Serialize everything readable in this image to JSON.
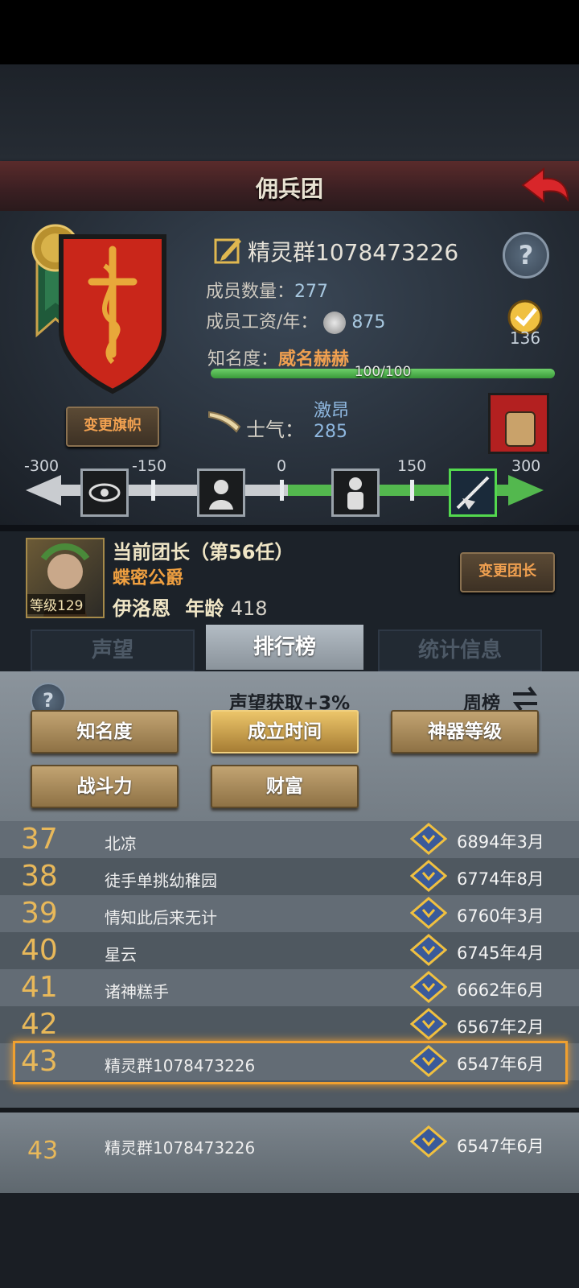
{
  "header": {
    "title": "佣兵团"
  },
  "guild": {
    "name": "精灵群1078473226",
    "members_label": "成员数量：",
    "members": "277",
    "salary_label": "成员工资/年：",
    "salary": "875",
    "fame_label": "知名度：",
    "fame": "威名赫赫",
    "fame_progress": "100/100",
    "fame_fraction": 1.0,
    "badge_value": "136",
    "change_flag_label": "变更旗帜"
  },
  "morale": {
    "label": "士气：",
    "state": "激昂",
    "value": "285",
    "ticks": [
      "-300",
      "-150",
      "0",
      "150",
      "300"
    ]
  },
  "leader": {
    "title": "当前团长（第56任）",
    "rank": "蝶密公爵",
    "name": "伊洛恩",
    "age_label": "年龄",
    "age": "418",
    "level_label": "等级",
    "level": "129",
    "change_label": "变更团长"
  },
  "tabs": [
    {
      "label": "声望",
      "active": false
    },
    {
      "label": "排行榜",
      "active": true
    },
    {
      "label": "统计信息",
      "active": false
    }
  ],
  "ranking": {
    "bonus": "声望获取+3%",
    "period": "周榜",
    "filters": [
      "知名度",
      "成立时间",
      "神器等级",
      "战斗力",
      "财富"
    ],
    "selected_filter": "成立时间",
    "rows": [
      {
        "rank": "37",
        "name": "北凉",
        "date": "6894年3月"
      },
      {
        "rank": "38",
        "name": "徒手单挑幼稚园",
        "date": "6774年8月"
      },
      {
        "rank": "39",
        "name": "情知此后来无计",
        "date": "6760年3月"
      },
      {
        "rank": "40",
        "name": "星云",
        "date": "6745年4月"
      },
      {
        "rank": "41",
        "name": "诸神糕手",
        "date": "6662年6月"
      },
      {
        "rank": "42",
        "name": "",
        "date": "6567年2月"
      },
      {
        "rank": "43",
        "name": "精灵群1078473226",
        "date": "6547年6月"
      }
    ],
    "my_row": {
      "rank": "43",
      "name": "精灵群1078473226",
      "date": "6547年6月"
    }
  },
  "colors": {
    "accent_orange": "#f0a030",
    "morale_green": "#53b84e",
    "header_red": "#5a2b2b"
  }
}
